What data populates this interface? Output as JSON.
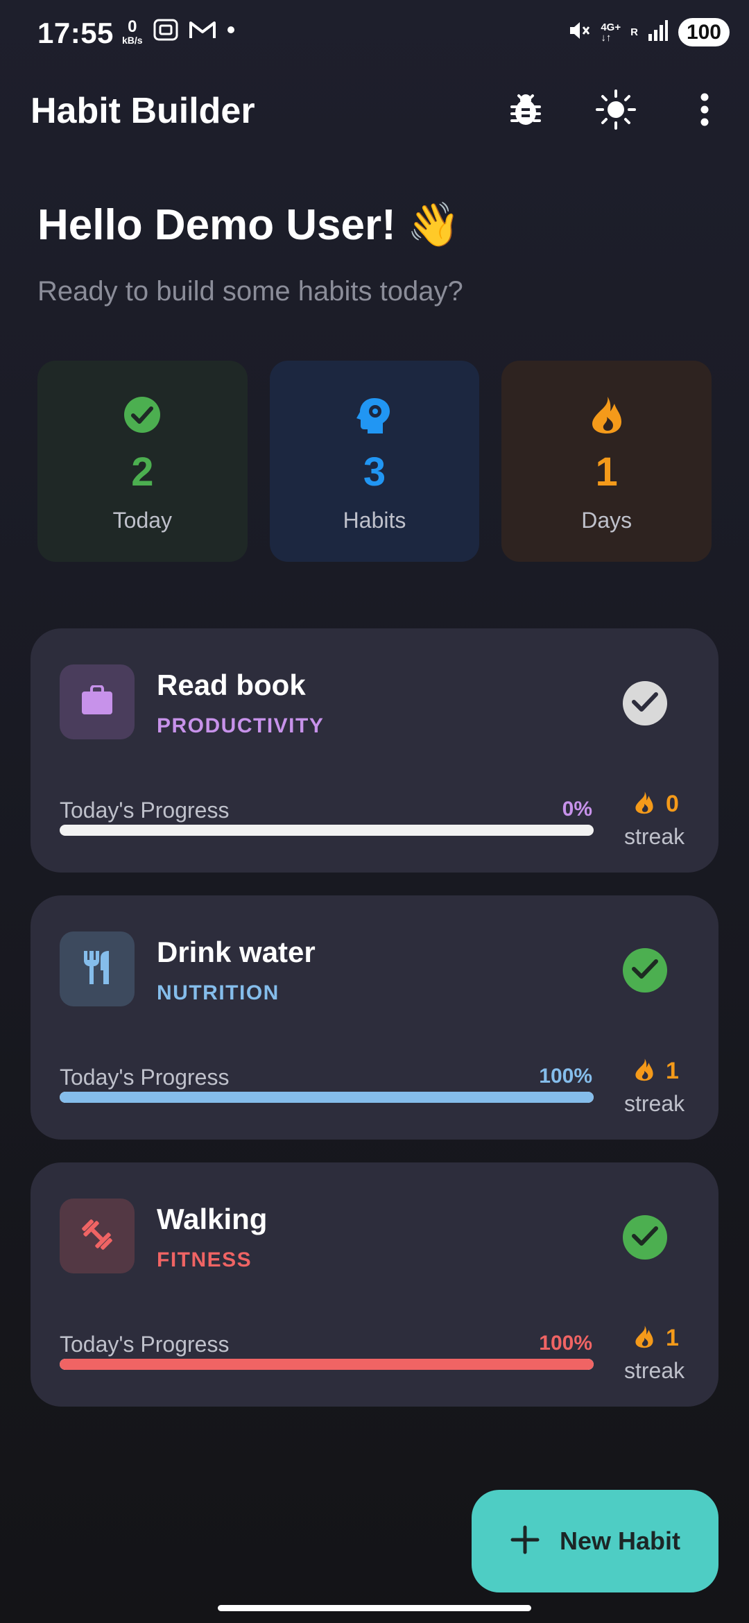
{
  "status_bar": {
    "time": "17:55",
    "net_speed_value": "0",
    "net_speed_unit": "kB/s",
    "network": "4G+",
    "network_sub": "R",
    "battery": "100"
  },
  "app_bar": {
    "title": "Habit Builder",
    "actions": [
      "bug-icon",
      "brightness-icon",
      "more-vert-icon"
    ]
  },
  "greeting": {
    "title": "Hello Demo User!",
    "emoji": "👋",
    "subtitle": "Ready to build some habits today?"
  },
  "stats": [
    {
      "value": "2",
      "label": "Today",
      "icon": "check-circle-icon",
      "color": "#4caf50"
    },
    {
      "value": "3",
      "label": "Habits",
      "icon": "psychology-icon",
      "color": "#2196f3"
    },
    {
      "value": "1",
      "label": "Days",
      "icon": "fire-icon",
      "color": "#f49a1a"
    }
  ],
  "habits": [
    {
      "name": "Read book",
      "category": "PRODUCTIVITY",
      "icon": "briefcase-icon",
      "color": "#c792ea",
      "progress_label": "Today's Progress",
      "progress_percent": "0%",
      "progress": 0,
      "completed": false,
      "streak": "0",
      "streak_label": "streak"
    },
    {
      "name": "Drink water",
      "category": "NUTRITION",
      "icon": "restaurant-icon",
      "color": "#85bdeb",
      "progress_label": "Today's Progress",
      "progress_percent": "100%",
      "progress": 1,
      "completed": true,
      "streak": "1",
      "streak_label": "streak"
    },
    {
      "name": "Walking",
      "category": "FITNESS",
      "icon": "dumbbell-icon",
      "color": "#f06464",
      "progress_label": "Today's Progress",
      "progress_percent": "100%",
      "progress": 1,
      "completed": true,
      "streak": "1",
      "streak_label": "streak"
    }
  ],
  "fab": {
    "label": "New Habit",
    "icon": "plus-icon"
  }
}
